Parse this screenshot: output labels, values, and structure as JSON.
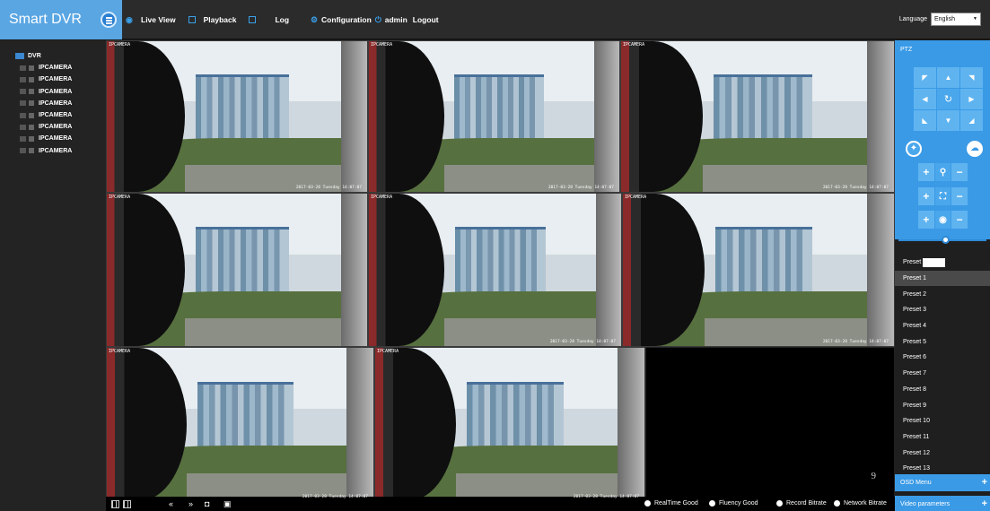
{
  "app": {
    "title": "Smart DVR"
  },
  "nav": {
    "live_view": "Live View",
    "playback": "Playback",
    "log": "Log",
    "configuration": "Configuration",
    "user": "admin",
    "logout": "Logout"
  },
  "language": {
    "label": "Language",
    "value": "English"
  },
  "tree": {
    "root": "DVR",
    "cameras": [
      "IPCAMERA",
      "IPCAMERA",
      "IPCAMERA",
      "IPCAMERA",
      "IPCAMERA",
      "IPCAMERA",
      "IPCAMERA",
      "IPCAMERA"
    ]
  },
  "grid": {
    "tiles": [
      {
        "label": "IPCAMERA",
        "stamp": "2017-03-28  Tuesday  14:07:07"
      },
      {
        "label": "IPCAMERA",
        "stamp": "2017-03-28  Tuesday  14:07:07"
      },
      {
        "label": "IPCAMERA",
        "stamp": "2017-03-28  Tuesday  14:07:07"
      },
      {
        "label": "IPCAMERA",
        "stamp": ""
      },
      {
        "label": "IPCAMERA",
        "stamp": "2017-03-28  Tuesday  14:07:07"
      },
      {
        "label": "IPCAMERA",
        "stamp": "2017-03-28  Tuesday  14:07:07"
      },
      {
        "label": "IPCAMERA",
        "stamp": "2017-03-28  Tuesday  14:07:07"
      },
      {
        "label": "IPCAMERA",
        "stamp": "2017-03-28  Tuesday  14:07:07"
      }
    ],
    "empty_tile_number": "9"
  },
  "status": {
    "realtime": "RealTime Good",
    "fluency": "Fluency Good",
    "record_bitrate": "Record Bitrate",
    "network_bitrate": "Network Bitrate"
  },
  "ptz": {
    "title": "PTZ",
    "preset_label": "Preset",
    "presets": [
      "Preset 1",
      "Preset 2",
      "Preset 3",
      "Preset 4",
      "Preset 5",
      "Preset 6",
      "Preset 7",
      "Preset 8",
      "Preset 9",
      "Preset 10",
      "Preset 11",
      "Preset 12",
      "Preset 13"
    ],
    "osd_menu": "OSD Menu",
    "video_parameters": "Video parameters"
  },
  "colors": {
    "accent": "#3a9ae6",
    "brand": "#5aa6e3",
    "background": "#1a1a1a"
  }
}
